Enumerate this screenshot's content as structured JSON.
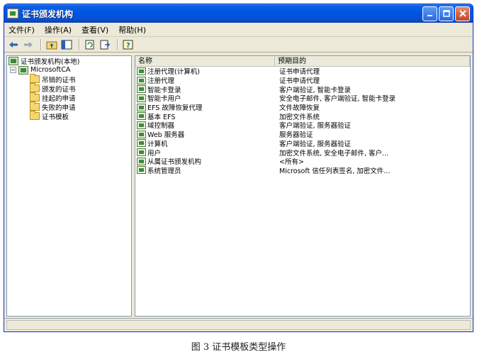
{
  "window": {
    "title": "证书颁发机构"
  },
  "menu": [
    {
      "label": "文件(F)"
    },
    {
      "label": "操作(A)"
    },
    {
      "label": "查看(V)"
    },
    {
      "label": "帮助(H)"
    }
  ],
  "toolbar": {
    "icons": [
      "back-arrow-icon",
      "forward-arrow-icon",
      "up-folder-icon",
      "show-hide-tree-icon",
      "refresh-icon",
      "export-list-icon",
      "help-icon"
    ]
  },
  "tree": {
    "root": "证书颁发机构(本地)",
    "ca": "MicrosoftCA",
    "children": [
      "吊销的证书",
      "颁发的证书",
      "挂起的申请",
      "失败的申请",
      "证书模板"
    ]
  },
  "list": {
    "columns": {
      "name": "名称",
      "purpose": "预期目的"
    },
    "rows": [
      {
        "name": "注册代理(计算机)",
        "purpose": "证书申请代理"
      },
      {
        "name": "注册代理",
        "purpose": "证书申请代理"
      },
      {
        "name": "智能卡登录",
        "purpose": "客户端验证, 智能卡登录"
      },
      {
        "name": "智能卡用户",
        "purpose": "安全电子邮件, 客户端验证, 智能卡登录"
      },
      {
        "name": "EFS 故障恢复代理",
        "purpose": "文件故障恢复"
      },
      {
        "name": "基本 EFS",
        "purpose": "加密文件系统"
      },
      {
        "name": "域控制器",
        "purpose": "客户端验证, 服务器验证"
      },
      {
        "name": "Web 服务器",
        "purpose": "服务器验证"
      },
      {
        "name": "计算机",
        "purpose": "客户端验证, 服务器验证"
      },
      {
        "name": "用户",
        "purpose": "加密文件系统, 安全电子邮件, 客户..."
      },
      {
        "name": "从属证书颁发机构",
        "purpose": "<所有>"
      },
      {
        "name": "系统管理员",
        "purpose": "Microsoft 信任列表签名, 加密文件..."
      }
    ]
  },
  "caption": "图 3 证书模板类型操作"
}
